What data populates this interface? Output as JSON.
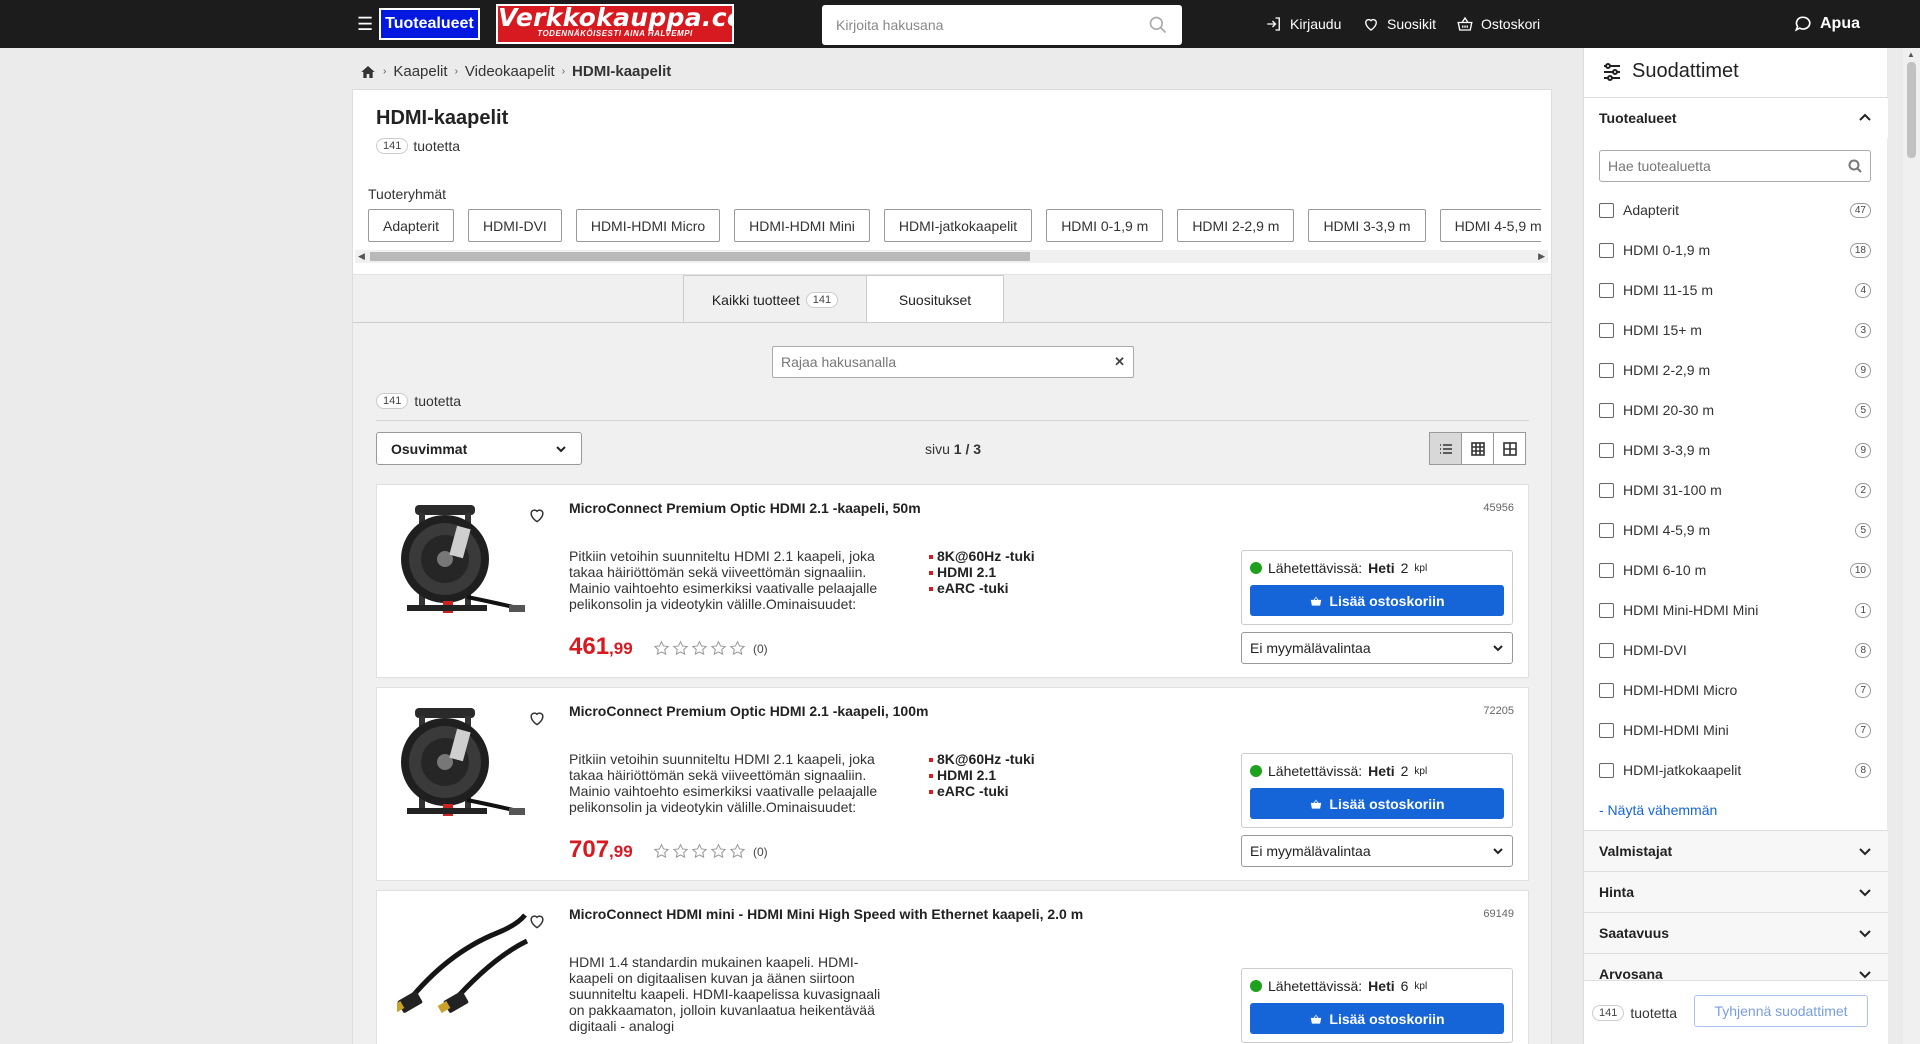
{
  "header": {
    "menu_label": "Tuotealueet",
    "logo_line1": "Verkkokauppa.com",
    "logo_line2": "TODENNÄKÖISESTI AINA HALVEMPI",
    "search_placeholder": "Kirjoita hakusana",
    "login": "Kirjaudu",
    "favorites": "Suosikit",
    "cart": "Ostoskori",
    "help": "Apua"
  },
  "breadcrumb": {
    "items": [
      "Kaapelit",
      "Videokaapelit"
    ],
    "current": "HDMI-kaapelit"
  },
  "category": {
    "title": "HDMI-kaapelit",
    "count": "141",
    "count_suffix": "tuotetta",
    "groups_label": "Tuoteryhmät",
    "groups": [
      "Adapterit",
      "HDMI-DVI",
      "HDMI-HDMI Micro",
      "HDMI-HDMI Mini",
      "HDMI-jatkokaapelit",
      "HDMI 0-1,9 m",
      "HDMI 2-2,9 m",
      "HDMI 3-3,9 m",
      "HDMI 4-5,9 m"
    ]
  },
  "tabs": [
    {
      "label": "Kaikki tuotteet",
      "count": "141"
    },
    {
      "label": "Suositukset"
    }
  ],
  "list": {
    "filter_placeholder": "Rajaa hakusanalla",
    "count": "141",
    "count_suffix": "tuotetta",
    "sort_value": "Osuvimmat",
    "page_prefix": "sivu",
    "page_value": "1 / 3"
  },
  "products": [
    {
      "title": "MicroConnect Premium Optic HDMI 2.1 -kaapeli, 50m",
      "sku": "45956",
      "description": "Pitkiin vetoihin suunniteltu HDMI 2.1 kaapeli, joka takaa häiriöttömän sekä viiveettömän signaaliin. Mainio vaihtoehto esimerkiksi vaativalle pelaajalle pelikonsolin ja videotykin välille.Ominaisuudet:",
      "features": [
        "8K@60Hz -tuki",
        "HDMI 2.1",
        "eARC -tuki"
      ],
      "price_int": "461",
      "price_dec": ",99",
      "rating_count": "(0)",
      "stock_label": "Lähetettävissä:",
      "stock_when": "Heti",
      "stock_qty": "2",
      "stock_unit": "kpl",
      "add_label": "Lisää ostoskoriin",
      "store_label": "Ei myymälävalintaa"
    },
    {
      "title": "MicroConnect Premium Optic HDMI 2.1 -kaapeli, 100m",
      "sku": "72205",
      "description": "Pitkiin vetoihin suunniteltu HDMI 2.1 kaapeli, joka takaa häiriöttömän sekä viiveettömän signaaliin. Mainio vaihtoehto esimerkiksi vaativalle pelaajalle pelikonsolin ja videotykin välille.Ominaisuudet:",
      "features": [
        "8K@60Hz -tuki",
        "HDMI 2.1",
        "eARC -tuki"
      ],
      "price_int": "707",
      "price_dec": ",99",
      "rating_count": "(0)",
      "stock_label": "Lähetettävissä:",
      "stock_when": "Heti",
      "stock_qty": "2",
      "stock_unit": "kpl",
      "add_label": "Lisää ostoskoriin",
      "store_label": "Ei myymälävalintaa"
    },
    {
      "title": "MicroConnect HDMI mini - HDMI Mini High Speed with Ethernet kaapeli, 2.0 m",
      "sku": "69149",
      "description": "HDMI 1.4 standardin mukainen kaapeli. HDMI-kaapeli on digitaalisen kuvan ja äänen siirtoon suunniteltu kaapeli. HDMI-kaapelissa kuvasignaali on pakkaamaton, jolloin kuvanlaatua heikentävää digitaali - analogi",
      "stock_label": "Lähetettävissä:",
      "stock_when": "Heti",
      "stock_qty": "6",
      "stock_unit": "kpl",
      "add_label": "Lisää ostoskoriin"
    }
  ],
  "sidebar": {
    "title": "Suodattimet",
    "section_categories": "Tuotealueet",
    "search_placeholder": "Hae tuotealuetta",
    "options": [
      {
        "label": "Adapterit",
        "count": "47"
      },
      {
        "label": "HDMI 0-1,9 m",
        "count": "18"
      },
      {
        "label": "HDMI 11-15 m",
        "count": "4"
      },
      {
        "label": "HDMI 15+ m",
        "count": "3"
      },
      {
        "label": "HDMI 2-2,9 m",
        "count": "9"
      },
      {
        "label": "HDMI 20-30 m",
        "count": "5"
      },
      {
        "label": "HDMI 3-3,9 m",
        "count": "9"
      },
      {
        "label": "HDMI 31-100 m",
        "count": "2"
      },
      {
        "label": "HDMI 4-5,9 m",
        "count": "5"
      },
      {
        "label": "HDMI 6-10 m",
        "count": "10"
      },
      {
        "label": "HDMI Mini-HDMI Mini",
        "count": "1"
      },
      {
        "label": "HDMI-DVI",
        "count": "8"
      },
      {
        "label": "HDMI-HDMI Micro",
        "count": "7"
      },
      {
        "label": "HDMI-HDMI Mini",
        "count": "7"
      },
      {
        "label": "HDMI-jatkokaapelit",
        "count": "8"
      }
    ],
    "show_less": "- Näytä vähemmän",
    "sections": [
      "Valmistajat",
      "Hinta",
      "Saatavuus",
      "Arvosana"
    ],
    "footer_count": "141",
    "footer_suffix": "tuotetta",
    "clear_label": "Tyhjennä suodattimet"
  },
  "colors": {
    "brand_red": "#d71920",
    "menu_blue": "#0018e0",
    "button_blue": "#1565d8",
    "stock_green": "#1ea21e"
  }
}
